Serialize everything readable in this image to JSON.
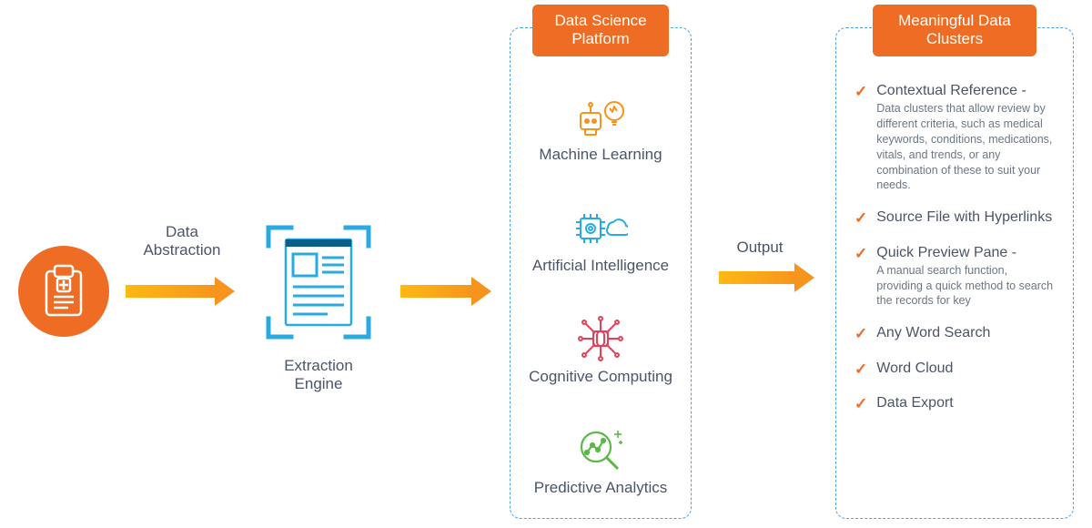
{
  "source": {
    "icon_name": "medical-clipboard-icon"
  },
  "arrow1": {
    "label": "Data\nAbstraction"
  },
  "engine": {
    "icon_name": "document-scan-icon",
    "label": "Extraction Engine"
  },
  "arrow2": {
    "label": ""
  },
  "dsp": {
    "title_line1": "Data Science",
    "title_line2": "Platform",
    "items": [
      {
        "icon": "robot-bulb-icon",
        "label": "Machine Learning",
        "color": "#f7941d"
      },
      {
        "icon": "chip-cloud-icon",
        "label": "Artificial Intelligence",
        "color": "#29abe2"
      },
      {
        "icon": "brain-circuit-icon",
        "label": "Cognitive Computing",
        "color": "#e83f5b"
      },
      {
        "icon": "analytics-lens-icon",
        "label": "Predictive Analytics",
        "color": "#5bb947"
      }
    ]
  },
  "arrow3": {
    "label": "Output"
  },
  "mdc": {
    "title_line1": "Meaningful Data",
    "title_line2": "Clusters",
    "items": [
      {
        "title": "Contextual Reference -",
        "desc": "Data clusters that allow review by different criteria, such as medical keywords, conditions, medications, vitals, and trends, or any combination of these to suit your needs."
      },
      {
        "title": "Source File with Hyperlinks",
        "desc": ""
      },
      {
        "title": "Quick Preview Pane -",
        "desc": "A manual search function, providing a quick method to search the records for key"
      },
      {
        "title": "Any Word Search",
        "desc": ""
      },
      {
        "title": "Word Cloud",
        "desc": ""
      },
      {
        "title": "Data Export",
        "desc": ""
      }
    ]
  }
}
